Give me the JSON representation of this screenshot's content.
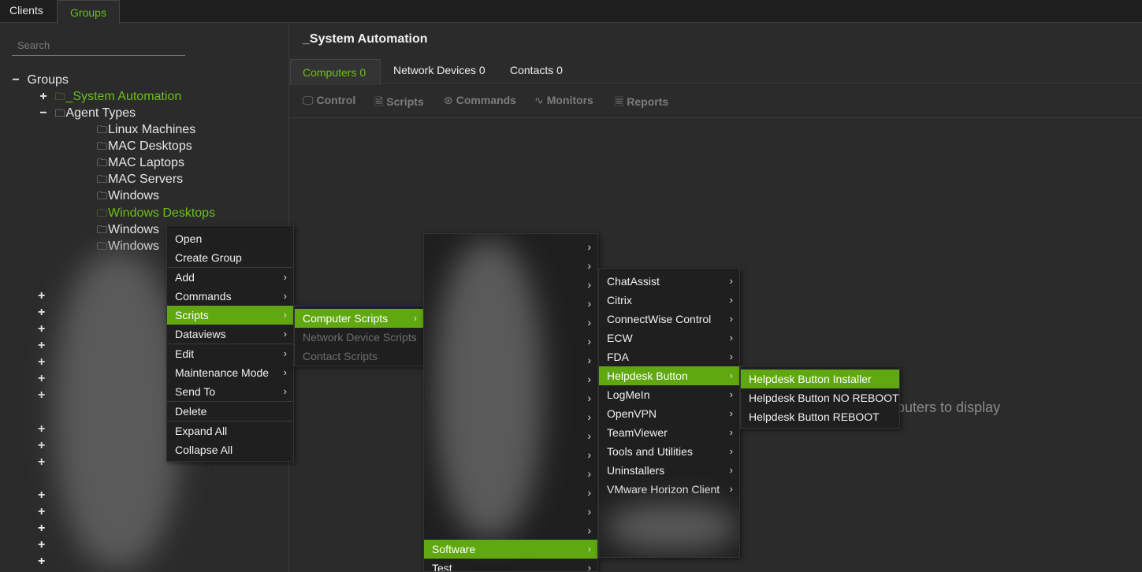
{
  "top_tabs": [
    "Clients",
    "Groups"
  ],
  "search": {
    "placeholder": "Search"
  },
  "tree": {
    "root": "Groups",
    "system_automation": "_System Automation",
    "agent_types": "Agent Types",
    "children": [
      "Linux Machines",
      "MAC Desktops",
      "MAC Laptops",
      "MAC Servers",
      "Windows",
      "Windows Desktops",
      "Windows",
      "Windows"
    ]
  },
  "right": {
    "title": "_System Automation",
    "tabs": [
      "Computers 0",
      "Network Devices 0",
      "Contacts 0"
    ],
    "toolbar": [
      "Control",
      "Scripts",
      "Commands",
      "Monitors",
      "Reports"
    ],
    "empty": "puters to display"
  },
  "context_menu": [
    "Open",
    "Create Group",
    "Add",
    "Commands",
    "Scripts",
    "Dataviews",
    "Edit",
    "Maintenance Mode",
    "Send To",
    "Delete",
    "Expand All",
    "Collapse All"
  ],
  "scripts_menu": [
    "Computer Scripts",
    "Network Device Scripts",
    "Contact Scripts"
  ],
  "folders_menu": [
    "Software",
    "Test"
  ],
  "software_menu": [
    "ChatAssist",
    "Citrix",
    "ConnectWise Control",
    "ECW",
    "FDA",
    "Helpdesk Button",
    "LogMeIn",
    "OpenVPN",
    "TeamViewer",
    "Tools and Utilities",
    "Uninstallers",
    "VMware Horizon Client"
  ],
  "helpdesk_menu": [
    "Helpdesk Button Installer",
    "Helpdesk Button NO REBOOT",
    "Helpdesk Button REBOOT"
  ],
  "colors": {
    "accent": "#6cbf1a",
    "highlight": "#5fa80f"
  }
}
